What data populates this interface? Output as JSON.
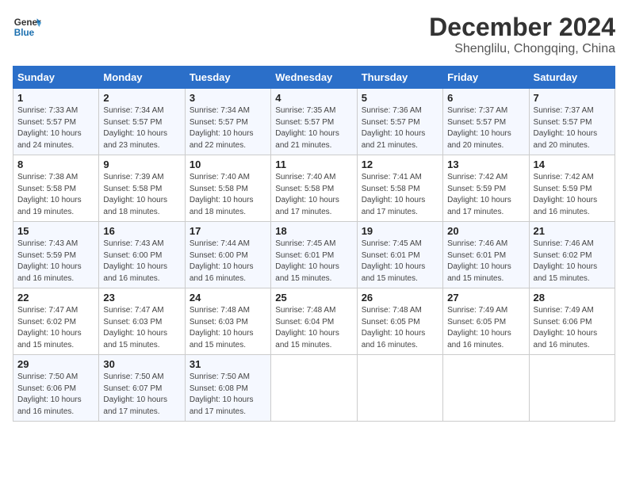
{
  "logo": {
    "line1": "General",
    "line2": "Blue"
  },
  "title": "December 2024",
  "subtitle": "Shenglilu, Chongqing, China",
  "days_of_week": [
    "Sunday",
    "Monday",
    "Tuesday",
    "Wednesday",
    "Thursday",
    "Friday",
    "Saturday"
  ],
  "weeks": [
    [
      {
        "day": "1",
        "info": "Sunrise: 7:33 AM\nSunset: 5:57 PM\nDaylight: 10 hours\nand 24 minutes."
      },
      {
        "day": "2",
        "info": "Sunrise: 7:34 AM\nSunset: 5:57 PM\nDaylight: 10 hours\nand 23 minutes."
      },
      {
        "day": "3",
        "info": "Sunrise: 7:34 AM\nSunset: 5:57 PM\nDaylight: 10 hours\nand 22 minutes."
      },
      {
        "day": "4",
        "info": "Sunrise: 7:35 AM\nSunset: 5:57 PM\nDaylight: 10 hours\nand 21 minutes."
      },
      {
        "day": "5",
        "info": "Sunrise: 7:36 AM\nSunset: 5:57 PM\nDaylight: 10 hours\nand 21 minutes."
      },
      {
        "day": "6",
        "info": "Sunrise: 7:37 AM\nSunset: 5:57 PM\nDaylight: 10 hours\nand 20 minutes."
      },
      {
        "day": "7",
        "info": "Sunrise: 7:37 AM\nSunset: 5:57 PM\nDaylight: 10 hours\nand 20 minutes."
      }
    ],
    [
      {
        "day": "8",
        "info": "Sunrise: 7:38 AM\nSunset: 5:58 PM\nDaylight: 10 hours\nand 19 minutes."
      },
      {
        "day": "9",
        "info": "Sunrise: 7:39 AM\nSunset: 5:58 PM\nDaylight: 10 hours\nand 18 minutes."
      },
      {
        "day": "10",
        "info": "Sunrise: 7:40 AM\nSunset: 5:58 PM\nDaylight: 10 hours\nand 18 minutes."
      },
      {
        "day": "11",
        "info": "Sunrise: 7:40 AM\nSunset: 5:58 PM\nDaylight: 10 hours\nand 17 minutes."
      },
      {
        "day": "12",
        "info": "Sunrise: 7:41 AM\nSunset: 5:58 PM\nDaylight: 10 hours\nand 17 minutes."
      },
      {
        "day": "13",
        "info": "Sunrise: 7:42 AM\nSunset: 5:59 PM\nDaylight: 10 hours\nand 17 minutes."
      },
      {
        "day": "14",
        "info": "Sunrise: 7:42 AM\nSunset: 5:59 PM\nDaylight: 10 hours\nand 16 minutes."
      }
    ],
    [
      {
        "day": "15",
        "info": "Sunrise: 7:43 AM\nSunset: 5:59 PM\nDaylight: 10 hours\nand 16 minutes."
      },
      {
        "day": "16",
        "info": "Sunrise: 7:43 AM\nSunset: 6:00 PM\nDaylight: 10 hours\nand 16 minutes."
      },
      {
        "day": "17",
        "info": "Sunrise: 7:44 AM\nSunset: 6:00 PM\nDaylight: 10 hours\nand 16 minutes."
      },
      {
        "day": "18",
        "info": "Sunrise: 7:45 AM\nSunset: 6:01 PM\nDaylight: 10 hours\nand 15 minutes."
      },
      {
        "day": "19",
        "info": "Sunrise: 7:45 AM\nSunset: 6:01 PM\nDaylight: 10 hours\nand 15 minutes."
      },
      {
        "day": "20",
        "info": "Sunrise: 7:46 AM\nSunset: 6:01 PM\nDaylight: 10 hours\nand 15 minutes."
      },
      {
        "day": "21",
        "info": "Sunrise: 7:46 AM\nSunset: 6:02 PM\nDaylight: 10 hours\nand 15 minutes."
      }
    ],
    [
      {
        "day": "22",
        "info": "Sunrise: 7:47 AM\nSunset: 6:02 PM\nDaylight: 10 hours\nand 15 minutes."
      },
      {
        "day": "23",
        "info": "Sunrise: 7:47 AM\nSunset: 6:03 PM\nDaylight: 10 hours\nand 15 minutes."
      },
      {
        "day": "24",
        "info": "Sunrise: 7:48 AM\nSunset: 6:03 PM\nDaylight: 10 hours\nand 15 minutes."
      },
      {
        "day": "25",
        "info": "Sunrise: 7:48 AM\nSunset: 6:04 PM\nDaylight: 10 hours\nand 15 minutes."
      },
      {
        "day": "26",
        "info": "Sunrise: 7:48 AM\nSunset: 6:05 PM\nDaylight: 10 hours\nand 16 minutes."
      },
      {
        "day": "27",
        "info": "Sunrise: 7:49 AM\nSunset: 6:05 PM\nDaylight: 10 hours\nand 16 minutes."
      },
      {
        "day": "28",
        "info": "Sunrise: 7:49 AM\nSunset: 6:06 PM\nDaylight: 10 hours\nand 16 minutes."
      }
    ],
    [
      {
        "day": "29",
        "info": "Sunrise: 7:50 AM\nSunset: 6:06 PM\nDaylight: 10 hours\nand 16 minutes."
      },
      {
        "day": "30",
        "info": "Sunrise: 7:50 AM\nSunset: 6:07 PM\nDaylight: 10 hours\nand 17 minutes."
      },
      {
        "day": "31",
        "info": "Sunrise: 7:50 AM\nSunset: 6:08 PM\nDaylight: 10 hours\nand 17 minutes."
      },
      {
        "day": "",
        "info": ""
      },
      {
        "day": "",
        "info": ""
      },
      {
        "day": "",
        "info": ""
      },
      {
        "day": "",
        "info": ""
      }
    ]
  ]
}
